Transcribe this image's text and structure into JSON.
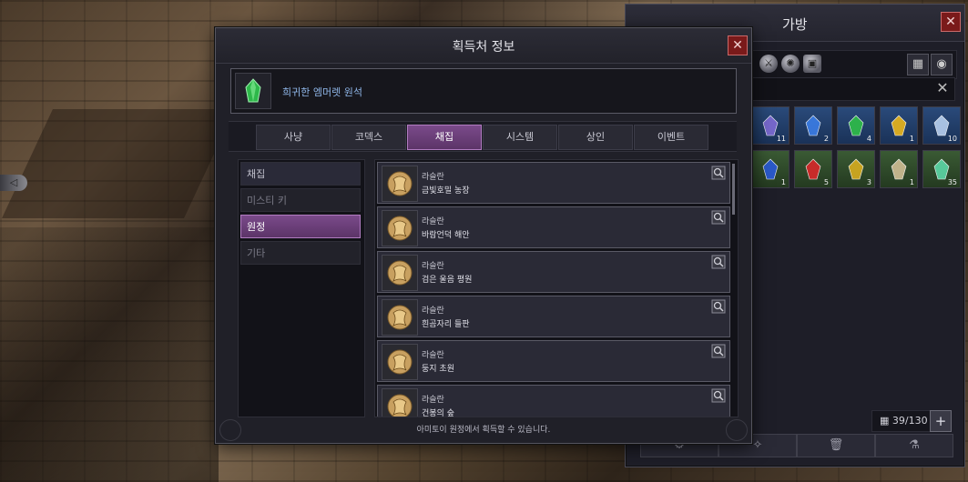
{
  "dialog": {
    "title": "획득처 정보",
    "close_icon": "✕",
    "item": {
      "name": "희귀한 엠머렛 원석",
      "icon": "green-gem-icon"
    },
    "tabs": [
      {
        "label": "사냥"
      },
      {
        "label": "코덱스"
      },
      {
        "label": "채집",
        "active": true
      },
      {
        "label": "시스템"
      },
      {
        "label": "상인"
      },
      {
        "label": "이벤트"
      }
    ],
    "categories": [
      {
        "label": "채집",
        "kind": "header"
      },
      {
        "label": "미스티 키"
      },
      {
        "label": "원정",
        "active": true
      },
      {
        "label": "기타"
      }
    ],
    "sources": [
      {
        "region": "라슬란",
        "place": "금빛호밀 농장"
      },
      {
        "region": "라슬란",
        "place": "바람언덕 해안"
      },
      {
        "region": "라슬란",
        "place": "검은 울음 평원"
      },
      {
        "region": "라슬란",
        "place": "흰곰자리 들판"
      },
      {
        "region": "라슬란",
        "place": "둥지 초원"
      },
      {
        "region": "라슬란",
        "place": "건봉의 숲"
      }
    ],
    "footer": "아미토이 원정에서 획득할 수 있습니다."
  },
  "bag": {
    "title": "가방",
    "close_icon": "✕",
    "clear_icon": "✕",
    "slot_count": "39/130",
    "plus_icon": "+",
    "slots_row1": [
      {
        "count": "11",
        "color": "#7a6ad0",
        "bg": "blue"
      },
      {
        "count": "2",
        "color": "#3a7ae0",
        "bg": "blue"
      },
      {
        "count": "4",
        "color": "#2eb84a",
        "bg": "blue"
      },
      {
        "count": "1",
        "color": "#e0b020",
        "bg": "blue"
      },
      {
        "count": "10",
        "color": "#b0c8e8",
        "bg": "blue"
      }
    ],
    "slots_row2": [
      {
        "count": "1",
        "color": "#2a5ad0",
        "bg": "green"
      },
      {
        "count": "5",
        "color": "#d02a2a",
        "bg": "green"
      },
      {
        "count": "3",
        "color": "#d0a820",
        "bg": "green"
      },
      {
        "count": "1",
        "color": "#c8b890",
        "bg": "green"
      },
      {
        "count": "35",
        "color": "#5ad0a0",
        "bg": "green"
      }
    ],
    "actions": [
      {
        "icon": "settings-icon",
        "glyph": "⚙"
      },
      {
        "icon": "star-icon",
        "glyph": "✧"
      },
      {
        "icon": "trash-icon",
        "glyph": "🗑"
      },
      {
        "icon": "flask-icon",
        "glyph": "⚗"
      }
    ]
  }
}
